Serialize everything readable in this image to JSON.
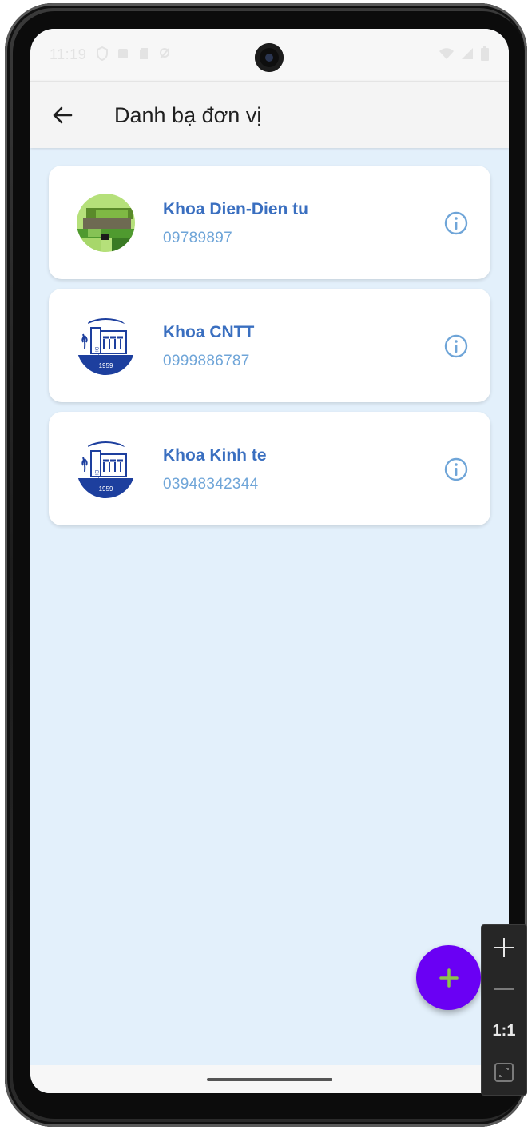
{
  "status_bar": {
    "time": "11:19",
    "left_icons": [
      "shield-icon",
      "app-icon",
      "sd-card-icon",
      "location-icon"
    ],
    "right_icons": [
      "wifi-icon",
      "signal-icon",
      "battery-icon"
    ]
  },
  "app_bar": {
    "title": "Danh bạ đơn vị",
    "back_icon": "arrow-left-icon"
  },
  "contacts": [
    {
      "name": "Khoa Dien-Dien tu",
      "phone": "09789897",
      "avatar": "pixel-art-avatar",
      "action_icon": "info-icon"
    },
    {
      "name": "Khoa CNTT",
      "phone": "0999886787",
      "avatar": "university-logo",
      "action_icon": "info-icon"
    },
    {
      "name": "Khoa Kinh te",
      "phone": "03948342344",
      "avatar": "university-logo",
      "action_icon": "info-icon"
    }
  ],
  "logo_text": {
    "year": "1959",
    "letters": "ĐHTL"
  },
  "fab": {
    "icon": "plus-icon"
  },
  "emulator_zoom": {
    "zoom_in_icon": "plus-icon",
    "zoom_out_icon": "minus-icon",
    "ratio_label": "1:1",
    "fit_icon": "fit-screen-icon"
  },
  "colors": {
    "background": "#e3f0fb",
    "name_text": "#3a6fc0",
    "phone_text": "#6fa5d8",
    "info_icon": "#6fa5d8",
    "fab_bg": "#6a00f4",
    "fab_icon": "#8bc34a",
    "logo_blue": "#1d3f9e"
  }
}
